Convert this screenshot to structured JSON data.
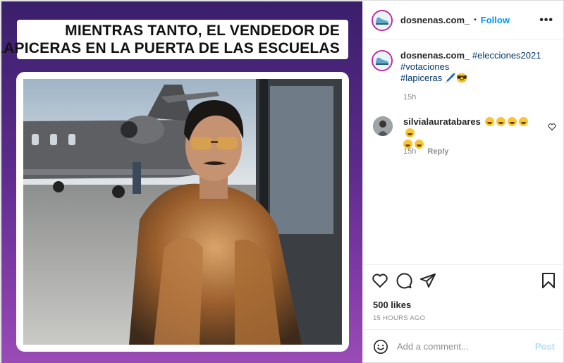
{
  "post": {
    "caption_lines": [
      "MIENTRAS TANTO, EL VENDEDOR DE",
      "LAPICERAS EN LA PUERTA DE LAS ESCUELAS"
    ]
  },
  "header": {
    "username": "dosnenas.com_",
    "separator": "•",
    "follow_label": "Follow",
    "more_label": "•••"
  },
  "caption": {
    "username": "dosnenas.com_",
    "hashtags": [
      "#elecciones2021",
      "#votaciones",
      "#lapiceras"
    ],
    "emoji_suffix": "🖊️😎",
    "time": "15h"
  },
  "comment": {
    "username": "silvialauratabares",
    "emoji_count": 7,
    "time": "15h",
    "reply_label": "Reply"
  },
  "actions": {
    "icons": [
      "heart-icon",
      "comment-icon",
      "share-icon",
      "bookmark-icon"
    ],
    "likes": "500 likes",
    "timestamp": "15 HOURS AGO"
  },
  "add_comment": {
    "placeholder": "Add a comment...",
    "post_label": "Post"
  },
  "colors": {
    "accent": "#0095f6",
    "post_disabled": "#b2dffc",
    "background_gradient_top": "#3a1f6b",
    "background_gradient_bottom": "#9a4bb6"
  }
}
